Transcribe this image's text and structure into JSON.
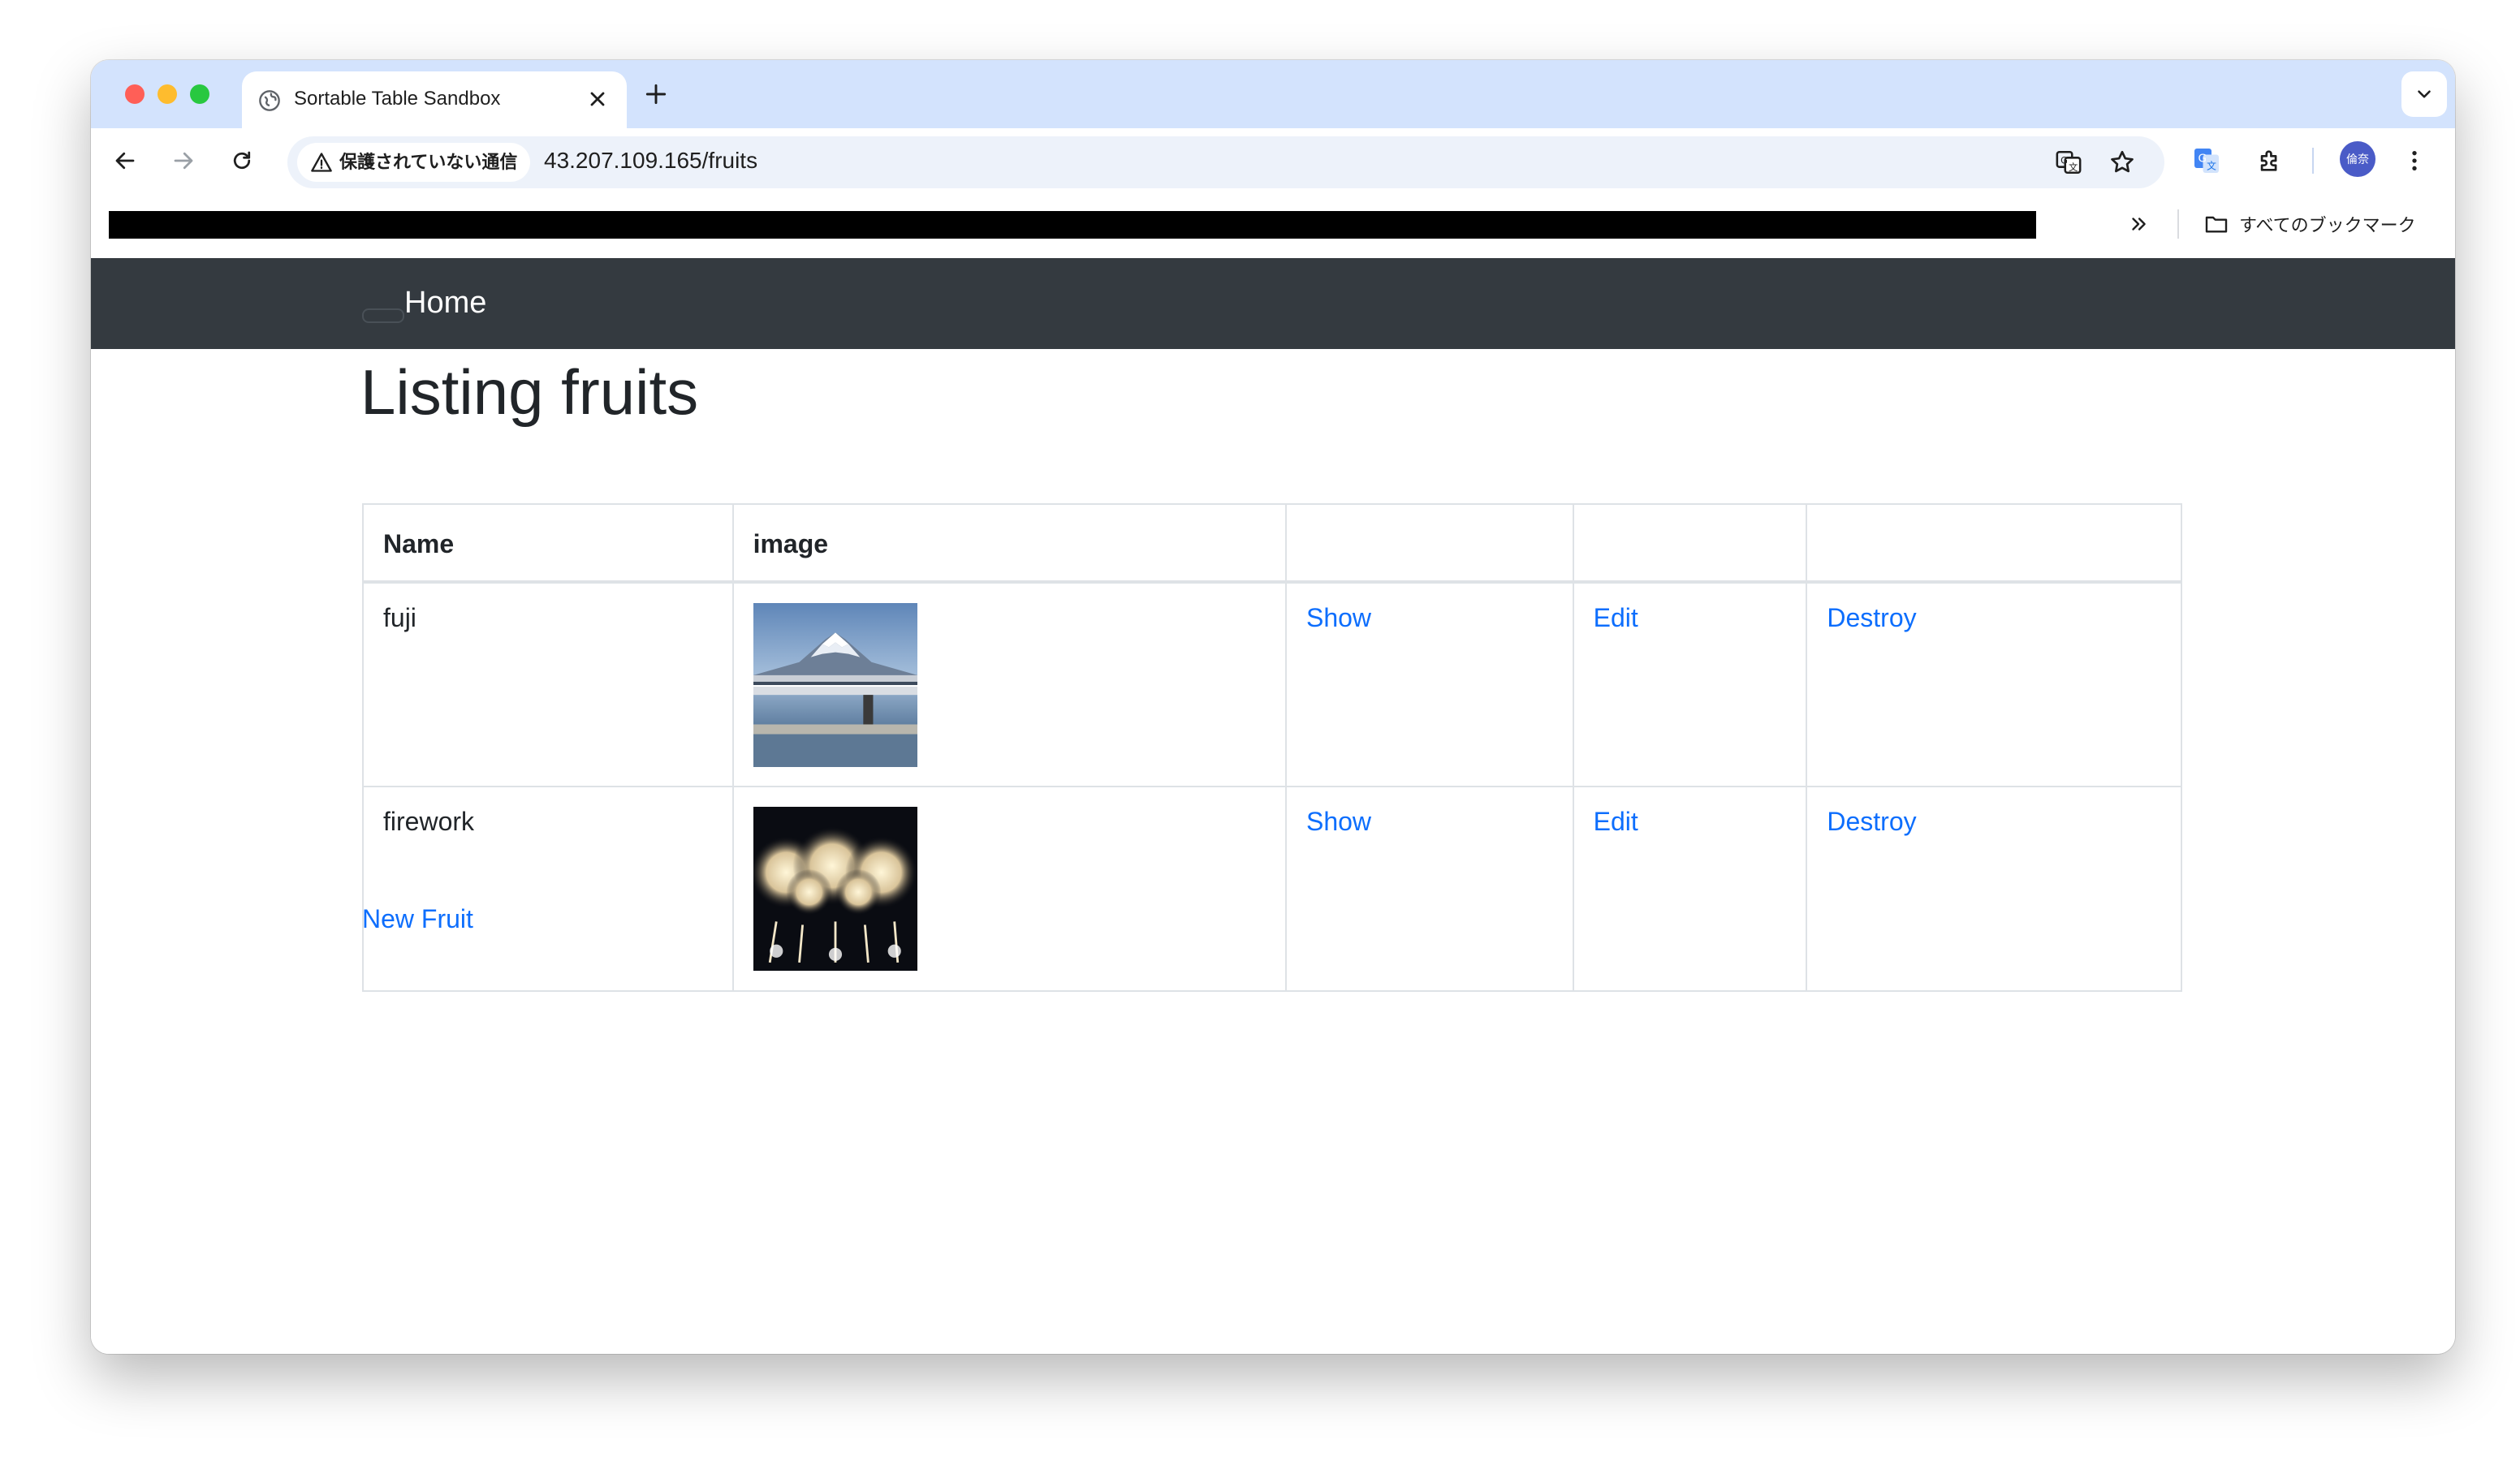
{
  "browser": {
    "tab_title": "Sortable Table Sandbox",
    "security_label": "保護されていない通信",
    "url": "43.207.109.165/fruits",
    "bookmarks_all_label": "すべてのブックマーク",
    "avatar_initials": "倫奈"
  },
  "navbar": {
    "home_label": "Home"
  },
  "page": {
    "title": "Listing fruits",
    "new_link": "New Fruit"
  },
  "table": {
    "headers": [
      "Name",
      "image",
      "",
      "",
      ""
    ],
    "rows": [
      {
        "name": "fuji",
        "image": "photo of Mount Fuji with a bullet train",
        "show": "Show",
        "edit": "Edit",
        "destroy": "Destroy"
      },
      {
        "name": "firework",
        "image": "photo of fireworks at night",
        "show": "Show",
        "edit": "Edit",
        "destroy": "Destroy"
      }
    ]
  },
  "colors": {
    "tabstrip": "#d3e3fd",
    "navbar": "#343a40",
    "link": "#0d6efd",
    "text": "#212529"
  }
}
